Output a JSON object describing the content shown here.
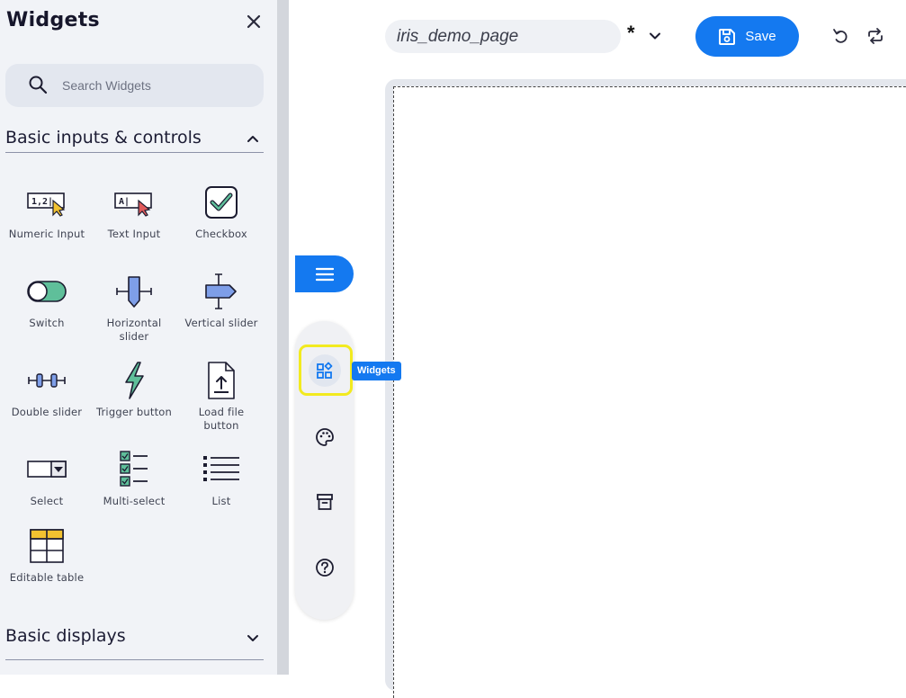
{
  "sidebar": {
    "title": "Widgets",
    "search_placeholder": "Search Widgets",
    "sections": {
      "basic_inputs": {
        "label": "Basic inputs & controls",
        "expanded": true
      },
      "basic_displays": {
        "label": "Basic displays",
        "expanded": false
      }
    },
    "widgets": [
      {
        "label": "Numeric Input",
        "icon": "numeric-input-icon"
      },
      {
        "label": "Text Input",
        "icon": "text-input-icon"
      },
      {
        "label": "Checkbox",
        "icon": "checkbox-icon"
      },
      {
        "label": "Switch",
        "icon": "switch-icon"
      },
      {
        "label": "Horizontal slider",
        "icon": "horizontal-slider-icon"
      },
      {
        "label": "Vertical slider",
        "icon": "vertical-slider-icon"
      },
      {
        "label": "Double slider",
        "icon": "double-slider-icon"
      },
      {
        "label": "Trigger button",
        "icon": "trigger-button-icon"
      },
      {
        "label": "Load file button",
        "icon": "load-file-button-icon"
      },
      {
        "label": "Select",
        "icon": "select-icon"
      },
      {
        "label": "Multi-select",
        "icon": "multi-select-icon"
      },
      {
        "label": "List",
        "icon": "list-icon"
      },
      {
        "label": "Editable table",
        "icon": "editable-table-icon"
      }
    ]
  },
  "toolbar": {
    "page_name": "iris_demo_page",
    "unsaved_marker": "*",
    "save_label": "Save"
  },
  "floating_toolbar": {
    "tooltip": "Widgets",
    "tools": [
      "widgets-icon",
      "palette-icon",
      "archive-icon",
      "help-icon"
    ]
  },
  "colors": {
    "accent": "#1479f0",
    "highlight": "#f2ea1f",
    "panel_bg": "#f1f3f7",
    "icon_green": "#5fbf9a",
    "icon_blue": "#7e9ee8",
    "icon_yellow": "#f2c230",
    "icon_red": "#e05a5a"
  }
}
